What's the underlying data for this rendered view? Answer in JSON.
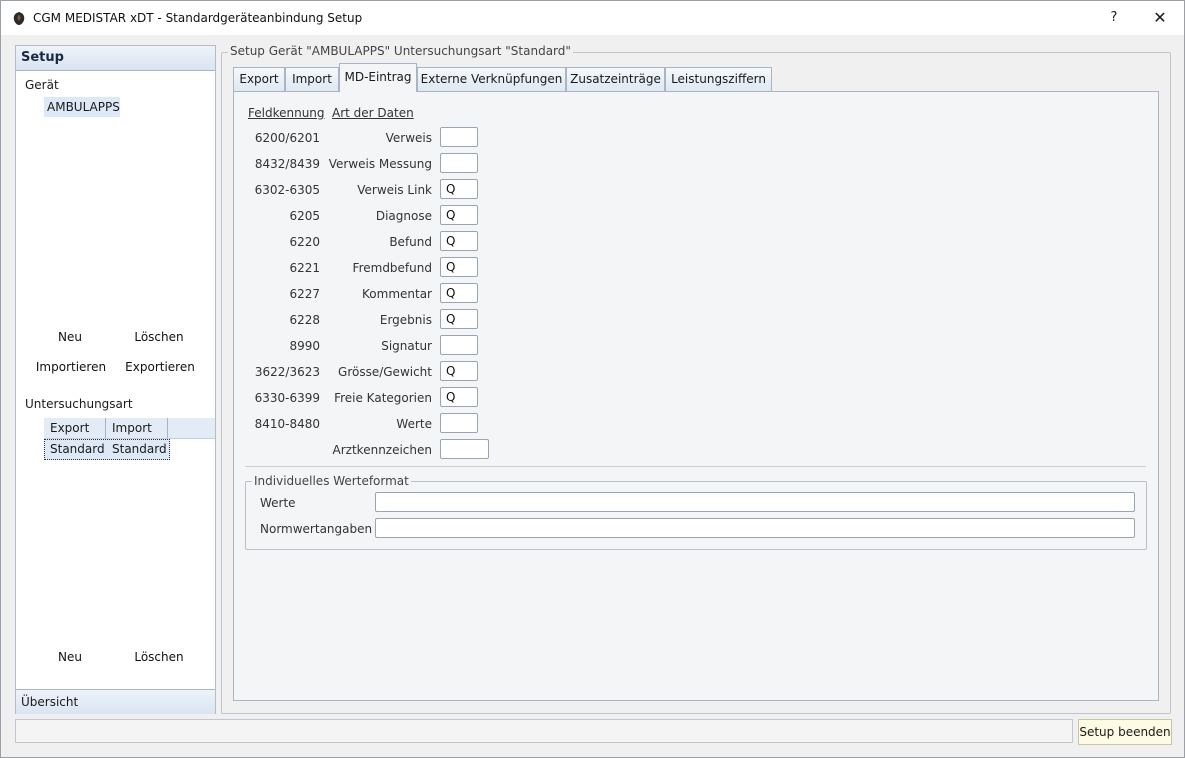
{
  "window": {
    "title": "CGM MEDISTAR xDT - Standardgeräteanbindung  Setup",
    "help_label": "?",
    "close_label": "✕"
  },
  "sidebar": {
    "header": "Setup",
    "device_label": "Gerät",
    "device_selected": "AMBULAPPS",
    "new_label": "Neu",
    "delete_label": "Löschen",
    "import_label": "Importieren",
    "export_label": "Exportieren",
    "exam_type_label": "Untersuchungsart",
    "exam_columns": [
      "Export",
      "Import"
    ],
    "exam_row": [
      "Standard",
      "Standard"
    ],
    "new2_label": "Neu",
    "delete2_label": "Löschen",
    "footer": "Übersicht"
  },
  "main": {
    "group_title": "Setup Gerät \"AMBULAPPS\" Untersuchungsart \"Standard\"",
    "tabs": [
      "Export",
      "Import",
      "MD-Eintrag",
      "Externe Verknüpfungen",
      "Zusatzeinträge",
      "Leistungsziffern"
    ],
    "active_tab": "MD-Eintrag",
    "col_field_id": "Feldkennung",
    "col_data_type": "Art der Daten",
    "rows": [
      {
        "code": "6200/6201",
        "type": "Verweis",
        "value": ""
      },
      {
        "code": "8432/8439",
        "type": "Verweis Messung",
        "value": ""
      },
      {
        "code": "6302-6305",
        "type": "Verweis Link",
        "value": "Q"
      },
      {
        "code": "6205",
        "type": "Diagnose",
        "value": "Q"
      },
      {
        "code": "6220",
        "type": "Befund",
        "value": "Q"
      },
      {
        "code": "6221",
        "type": "Fremdbefund",
        "value": "Q"
      },
      {
        "code": "6227",
        "type": "Kommentar",
        "value": "Q"
      },
      {
        "code": "6228",
        "type": "Ergebnis",
        "value": "Q"
      },
      {
        "code": "8990",
        "type": "Signatur",
        "value": ""
      },
      {
        "code": "3622/3623",
        "type": "Grösse/Gewicht",
        "value": "Q"
      },
      {
        "code": "6330-6399",
        "type": "Freie Kategorien",
        "value": "Q"
      },
      {
        "code": "8410-8480",
        "type": "Werte",
        "value": ""
      },
      {
        "code": "",
        "type": "Arztkennzeichen",
        "value": ""
      }
    ],
    "individual_format": {
      "title": "Individuelles Werteformat",
      "werte_label": "Werte",
      "werte_value": "",
      "norm_label": "Normwertangaben",
      "norm_value": ""
    }
  },
  "footer": {
    "status_text": "",
    "finish_label": "Setup beenden"
  }
}
